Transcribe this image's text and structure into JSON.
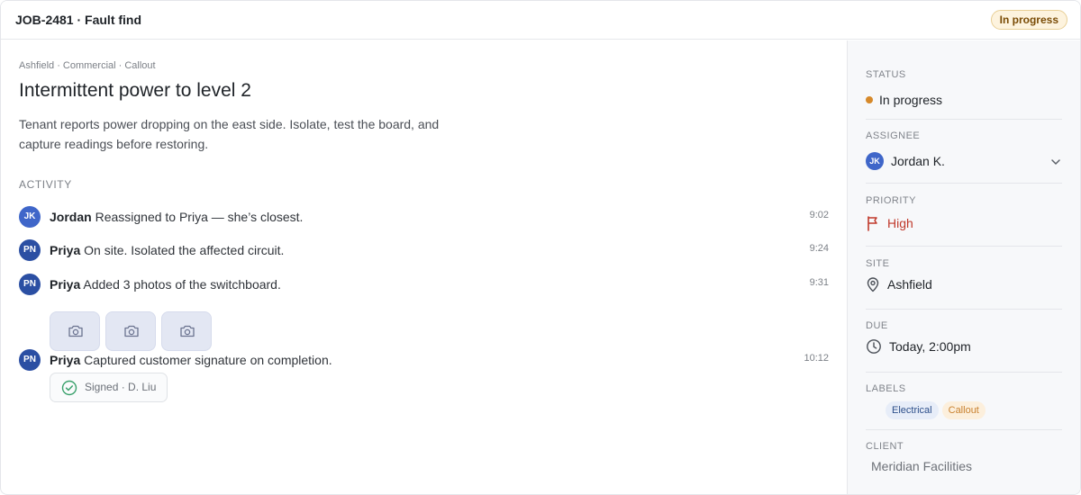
{
  "header": {
    "title": "JOB-2481 · Fault find",
    "status_badge": "In progress"
  },
  "job": {
    "breadcrumb": "Ashfield · Commercial · Callout",
    "title": "Intermittent power to level 2",
    "description": "Tenant reports power dropping on the east side. Isolate, test the board, and capture readings before restoring."
  },
  "activity": {
    "label": "ACTIVITY",
    "entries": [
      {
        "initials": "JK",
        "author": "Jordan",
        "text": "Reassigned to Priya — she’s closest.",
        "time": "9:02",
        "avatar_color": "#3f66c9"
      },
      {
        "initials": "PN",
        "author": "Priya",
        "text": "On site. Isolated the affected circuit.",
        "time": "9:24",
        "avatar_color": "#2b4fa3"
      },
      {
        "initials": "PN",
        "author": "Priya",
        "text": "Added 3 photos of the switchboard.",
        "time": "9:31",
        "avatar_color": "#2b4fa3"
      },
      {
        "initials": "PN",
        "author": "Priya",
        "text": "Captured customer signature on completion.",
        "time": "10:12",
        "avatar_color": "#2b4fa3",
        "chip": "Signed · D. Liu"
      }
    ],
    "photo_icons": [
      "camera-icon",
      "camera-icon",
      "camera-icon"
    ]
  },
  "sidebar": {
    "status": {
      "label": "STATUS",
      "value": "In progress",
      "color": "#d6892a"
    },
    "assignee": {
      "label": "ASSIGNEE",
      "initials": "JK",
      "name": "Jordan K.",
      "color": "#3f66c9"
    },
    "priority": {
      "label": "PRIORITY",
      "value": "High",
      "color": "#c0392b",
      "icon": "flag-icon"
    },
    "site": {
      "label": "SITE",
      "value": "Ashfield",
      "icon": "map-pin-icon"
    },
    "due": {
      "label": "DUE",
      "value": "Today, 2:00pm",
      "icon": "clock-icon"
    },
    "labels": {
      "label": "LABELS",
      "items": [
        "Electrical",
        "Callout"
      ]
    },
    "client": {
      "label": "CLIENT",
      "value": "Meridian Facilities"
    }
  }
}
